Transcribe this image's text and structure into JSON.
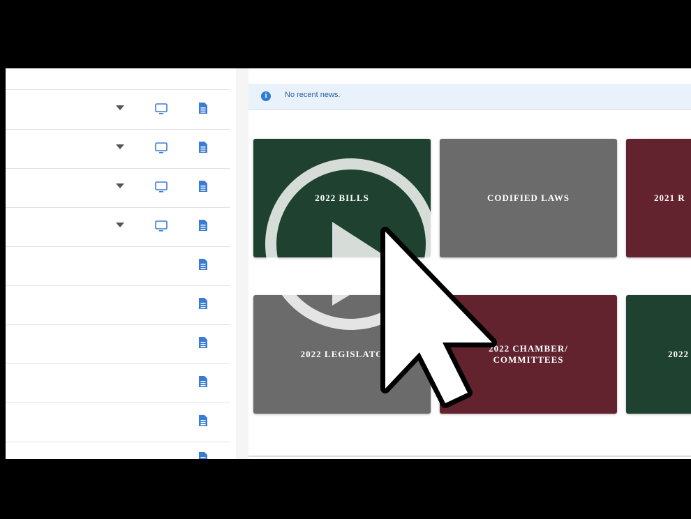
{
  "news": {
    "message": "No recent news."
  },
  "tiles": [
    {
      "label": "2022 BILLS",
      "color": "#1f4230"
    },
    {
      "label": "CODIFIED LAWS",
      "color": "#6b6b6b"
    },
    {
      "label": "2021 R",
      "color": "#62222e"
    },
    {
      "label": "2022 LEGISLATO",
      "color": "#6b6b6b"
    },
    {
      "label_line1": "2022 CHAMBER/",
      "label_line2": "COMMITTEES",
      "color": "#62222e"
    },
    {
      "label": "2022",
      "color": "#1f4230"
    }
  ],
  "sidebar": {
    "rows_with_dropdown": 4,
    "rows_total": 10
  },
  "icons": {
    "info": "info-icon",
    "chevron": "chevron-down-icon",
    "monitor": "monitor-icon",
    "document": "document-icon",
    "play": "play-icon",
    "cursor": "cursor-icon"
  },
  "colors": {
    "accent_blue": "#2f7cd0",
    "tile_green": "#1f4230",
    "tile_gray": "#6b6b6b",
    "tile_maroon": "#62222e"
  }
}
